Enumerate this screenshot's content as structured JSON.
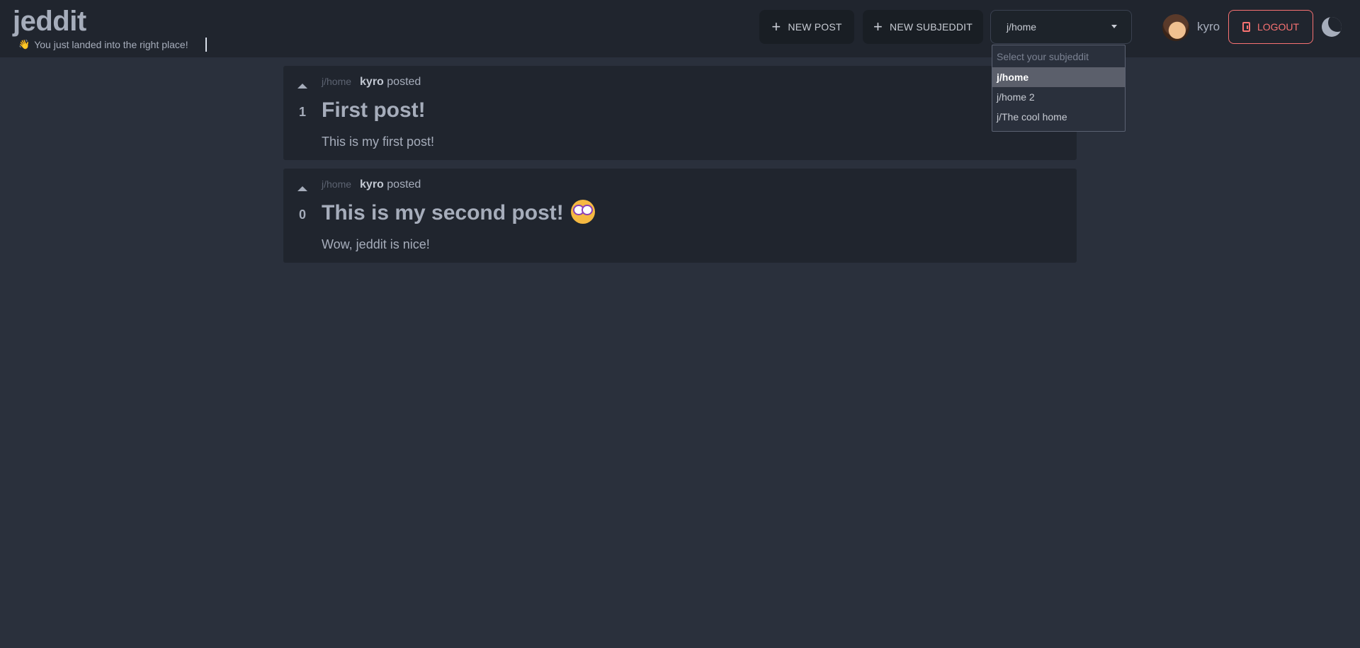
{
  "brand": {
    "title": "jeddit",
    "tagline_icon": "👋",
    "tagline": "You just landed into the right place!"
  },
  "header": {
    "new_post_label": "NEW POST",
    "new_subjeddit_label": "NEW SUBJEDDIT",
    "selected_subjeddit": "j/home",
    "username": "kyro",
    "logout_label": "LOGOUT"
  },
  "dropdown": {
    "placeholder": "Select your subjeddit",
    "options": [
      "j/home",
      "j/home 2",
      "j/The cool home"
    ],
    "selected_index": 0
  },
  "posts": [
    {
      "votes": "1",
      "subjeddit": "j/home",
      "author": "kyro",
      "action": "posted",
      "title": "First post!",
      "body": "This is my first post!"
    },
    {
      "votes": "0",
      "subjeddit": "j/home",
      "author": "kyro",
      "action": "posted",
      "title": "This is my second post!",
      "title_icon": "nerd-face-emoji",
      "body": "Wow, jeddit is nice!"
    }
  ],
  "colors": {
    "background": "#2a303c",
    "surface": "#20252e",
    "text": "#a6adbb",
    "logout_accent": "#f87272"
  }
}
